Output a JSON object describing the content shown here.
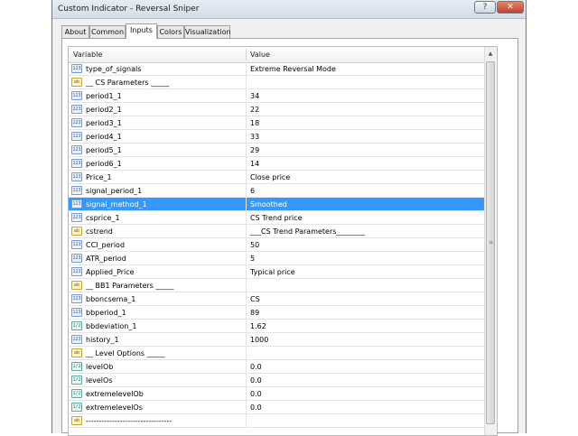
{
  "window": {
    "title": "Custom Indicator - Reversal Sniper",
    "help_label": "?",
    "close_label": "✕"
  },
  "tabs": [
    "About",
    "Common",
    "Inputs",
    "Colors",
    "Visualization"
  ],
  "active_tab": "Inputs",
  "grid": {
    "headers": {
      "variable": "Variable",
      "value": "Value"
    },
    "rows": [
      {
        "icon": "123",
        "name": "type_of_signals",
        "value": "Extreme Reversal Mode"
      },
      {
        "icon": "ab",
        "name": "__ CS Parameters _____",
        "value": ""
      },
      {
        "icon": "123",
        "name": "period1_1",
        "value": "34"
      },
      {
        "icon": "123",
        "name": "period2_1",
        "value": "22"
      },
      {
        "icon": "123",
        "name": "period3_1",
        "value": "18"
      },
      {
        "icon": "123",
        "name": "period4_1",
        "value": "33"
      },
      {
        "icon": "123",
        "name": "period5_1",
        "value": "29"
      },
      {
        "icon": "123",
        "name": "period6_1",
        "value": "14"
      },
      {
        "icon": "123",
        "name": "Price_1",
        "value": "Close price"
      },
      {
        "icon": "123",
        "name": "signal_period_1",
        "value": "6"
      },
      {
        "icon": "123",
        "name": "signal_method_1",
        "value": "Smoothed"
      },
      {
        "icon": "123",
        "name": "csprice_1",
        "value": "CS Trend price"
      },
      {
        "icon": "ab",
        "name": "cstrend",
        "value": "___CS Trend Parameters________"
      },
      {
        "icon": "123",
        "name": "CCI_period",
        "value": "50"
      },
      {
        "icon": "123",
        "name": "ATR_period",
        "value": "5"
      },
      {
        "icon": "123",
        "name": "Applied_Price",
        "value": "Typical price"
      },
      {
        "icon": "ab",
        "name": "__ BB1 Parameters _____",
        "value": ""
      },
      {
        "icon": "123",
        "name": "bboncsema_1",
        "value": "CS"
      },
      {
        "icon": "123",
        "name": "bbperiod_1",
        "value": "89"
      },
      {
        "icon": "1/2",
        "name": "bbdeviation_1",
        "value": "1.62"
      },
      {
        "icon": "123",
        "name": "history_1",
        "value": "1000"
      },
      {
        "icon": "ab",
        "name": "__ Level Options _____",
        "value": ""
      },
      {
        "icon": "1/2",
        "name": "levelOb",
        "value": "0.0"
      },
      {
        "icon": "1/2",
        "name": "levelOs",
        "value": "0.0"
      },
      {
        "icon": "1/2",
        "name": "extremelevelOb",
        "value": "0.0"
      },
      {
        "icon": "1/2",
        "name": "extremelevelOs",
        "value": "0.0"
      },
      {
        "icon": "ab",
        "name": "---------------------------------",
        "value": ""
      }
    ],
    "selected_row": "signal_method_1"
  },
  "colors": {
    "selection": "#3399ff",
    "panel": "#f0f0f0"
  }
}
